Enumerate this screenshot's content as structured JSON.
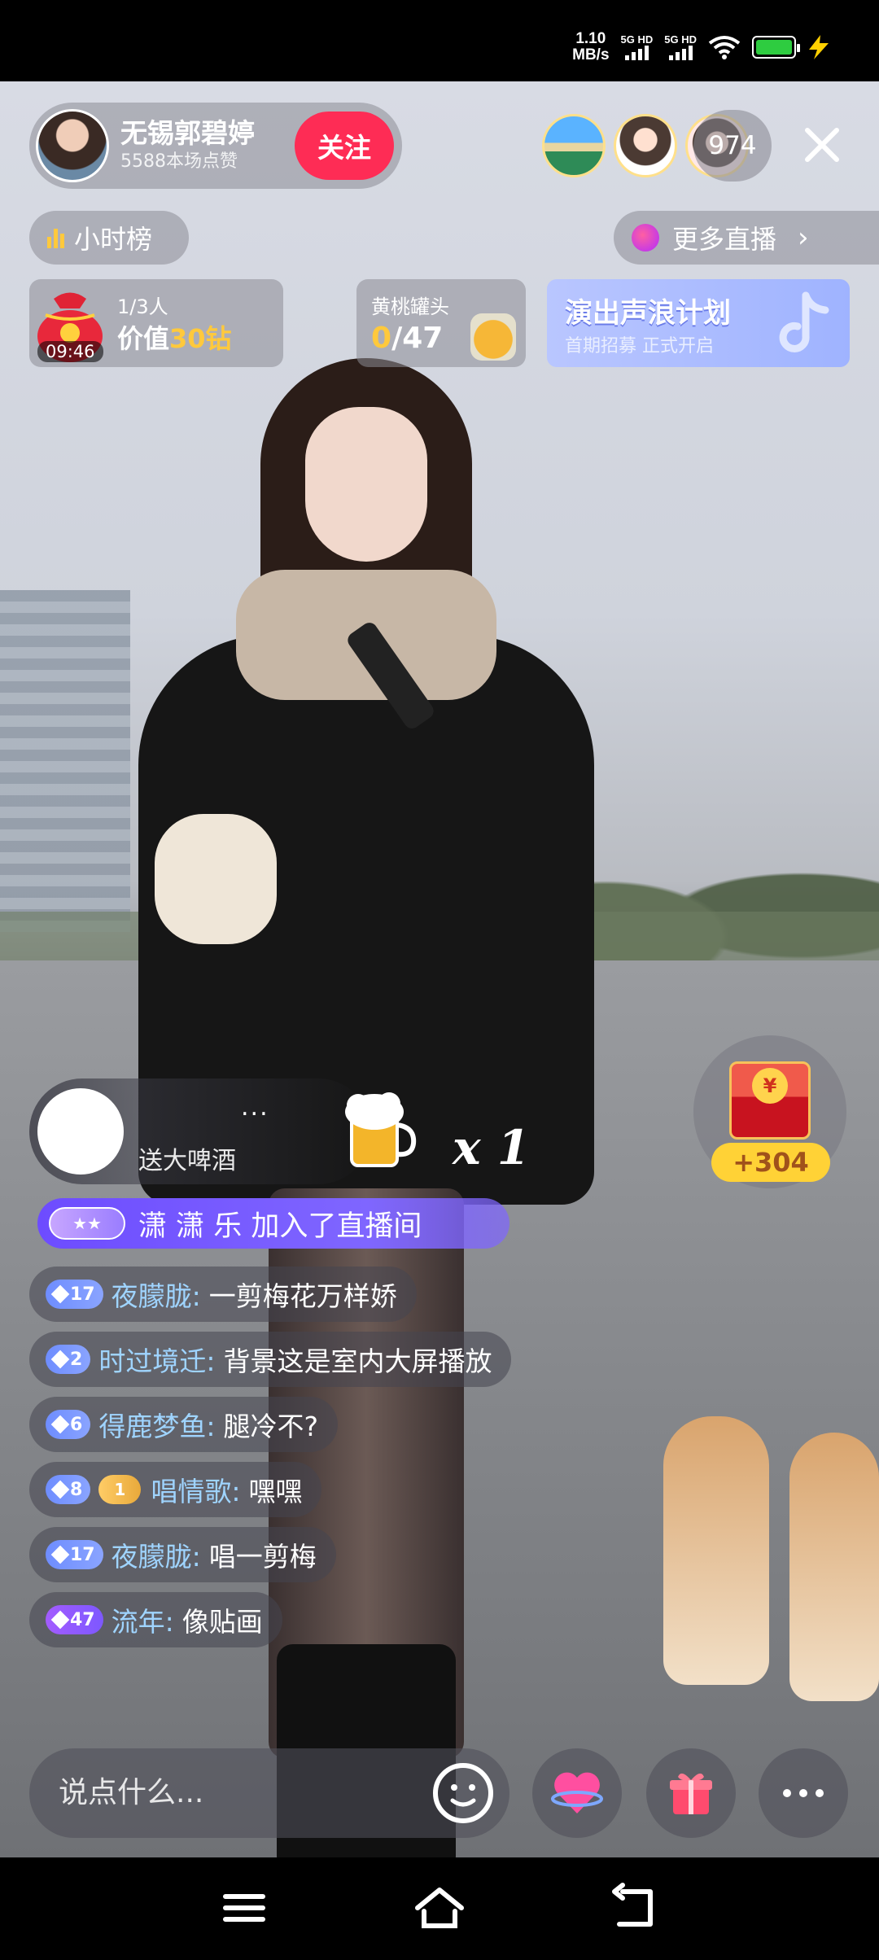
{
  "status_bar": {
    "net_speed": "1.10",
    "net_speed_unit": "MB/s",
    "sim1": "5G HD",
    "sim2": "5G HD",
    "battery_color": "#2ecc40"
  },
  "host": {
    "name": "无锡郭碧婷",
    "likes": "5588本场点赞",
    "follow_label": "关注",
    "follow_color": "#fe2c55"
  },
  "viewers": {
    "count": "974"
  },
  "rank": {
    "label": "小时榜"
  },
  "more_live": {
    "label": "更多直播"
  },
  "red_packet": {
    "people": "1/3人",
    "value_prefix": "价值",
    "value_amount": "30钻",
    "timer": "09:46"
  },
  "peach_task": {
    "title": "黄桃罐头",
    "current": "0",
    "total": "/47"
  },
  "banner": {
    "title": "演出声浪计划",
    "subtitle": "首期招募 正式开启"
  },
  "gift": {
    "dots": "...",
    "text": "送大啤酒",
    "count": "x 1"
  },
  "chest": {
    "coin": "¥",
    "reward": "+304"
  },
  "join": {
    "badge": "★★",
    "text": "潇 潇 乐 加入了直播间",
    "color": "#6d4cff"
  },
  "comments": [
    {
      "level": "17",
      "fan": "",
      "user": "夜朦胧:",
      "text": "一剪梅花万样娇"
    },
    {
      "level": "2",
      "fan": "",
      "user": "时过境迁:",
      "text": "背景这是室内大屏播放"
    },
    {
      "level": "6",
      "fan": "",
      "user": "得鹿梦鱼:",
      "text": "腿冷不?"
    },
    {
      "level": "8",
      "fan": "1",
      "user": "唱情歌:",
      "text": "嘿嘿"
    },
    {
      "level": "17",
      "fan": "",
      "user": "夜朦胧:",
      "text": "唱一剪梅"
    },
    {
      "level": "47",
      "fan": "",
      "user": "流年:",
      "text": "像贴画"
    }
  ],
  "input": {
    "placeholder": "说点什么..."
  }
}
